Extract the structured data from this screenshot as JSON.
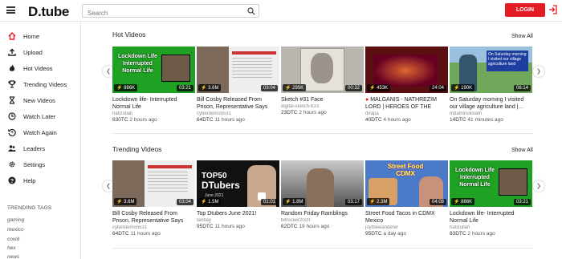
{
  "header": {
    "logo": "D.tube",
    "search_placeholder": "Search",
    "login_label": "LOGIN"
  },
  "sidebar": {
    "items": [
      {
        "label": "Home",
        "icon": "home-icon",
        "active": true
      },
      {
        "label": "Upload",
        "icon": "upload-icon"
      },
      {
        "label": "Hot Videos",
        "icon": "fire-icon"
      },
      {
        "label": "Trending Videos",
        "icon": "trophy-icon"
      },
      {
        "label": "New Videos",
        "icon": "hourglass-icon"
      },
      {
        "label": "Watch Later",
        "icon": "clock-icon"
      },
      {
        "label": "Watch Again",
        "icon": "history-icon"
      },
      {
        "label": "Leaders",
        "icon": "users-icon"
      },
      {
        "label": "Settings",
        "icon": "gear-icon"
      },
      {
        "label": "Help",
        "icon": "help-icon"
      }
    ],
    "tags_title": "TRENDING TAGS",
    "tags": [
      "gaming",
      "mexico",
      "covid",
      "hex",
      "news"
    ]
  },
  "colors": {
    "accent": "#e31b23",
    "thumb_green": "#1fa224"
  },
  "hot": {
    "title": "Hot Videos",
    "show_all": "Show All",
    "videos": [
      {
        "value": "886K",
        "duration": "03:21",
        "title": "Lockdown life- Interrupted Normal Life",
        "author": "hafizullah",
        "dtc": "830TC",
        "age": "2 hours ago",
        "thumb_text": "Lockdown Life Interrupted Normal Life"
      },
      {
        "value": "3.6M",
        "duration": "03:04",
        "title": "Bill Cosby Released From Prison, Representative Says \"Great Day…",
        "author": "cyberdemon531",
        "dtc": "64DTC",
        "age": "11 hours ago"
      },
      {
        "value": "295K",
        "duration": "00:32",
        "title": "Sketch #31 Face",
        "author": "digital-sketch-b33",
        "dtc": "23DTC",
        "age": "2 hours ago"
      },
      {
        "value": "453K",
        "duration": "24:04",
        "title": "MALGANIS - NATHREZIM LORD | HEROES OF THE STORM…",
        "author": "dirapa",
        "dtc": "40DTC",
        "age": "4 hours ago"
      },
      {
        "value": "190K",
        "duration": "06:14",
        "title": "On Saturday morning I visited our village agriculture land |…",
        "author": "mdaminulislam",
        "dtc": "14DTC",
        "age": "41 minutes ago",
        "thumb_text": "On Saturday morning I visited our village agriculture land"
      }
    ]
  },
  "trending": {
    "title": "Trending Videos",
    "show_all": "Show All",
    "videos": [
      {
        "value": "3.6M",
        "duration": "03:04",
        "title": "Bill Cosby Released From Prison, Representative Says \"Great Day…",
        "author": "cyberdemon531",
        "dtc": "64DTC",
        "age": "11 hours ago"
      },
      {
        "value": "1.5M",
        "duration": "01:01",
        "title": "Top Dtubers June 2021!",
        "author": "tanbay",
        "dtc": "95DTC",
        "age": "11 hours ago",
        "thumb_line1": "TOP50",
        "thumb_line2": "DTubers",
        "thumb_line3": "June 2021"
      },
      {
        "value": "1.8M",
        "duration": "03:17",
        "title": "Random Friday Ramblings",
        "author": "bitrocker2020",
        "dtc": "62DTC",
        "age": "19 hours ago"
      },
      {
        "value": "2.3M",
        "duration": "04:08",
        "title": "Street Food Tacos in CDMX Mexico",
        "author": "joythewanderer",
        "dtc": "95DTC",
        "age": "a day ago",
        "thumb_text": "Street Food CDMX"
      },
      {
        "value": "886K",
        "duration": "03:21",
        "title": "Lockdown life- Interrupted Normal Life",
        "author": "hafizullah",
        "dtc": "83DTC",
        "age": "2 hours ago",
        "thumb_text": "Lockdown Life Interrupted Normal Life"
      }
    ]
  }
}
